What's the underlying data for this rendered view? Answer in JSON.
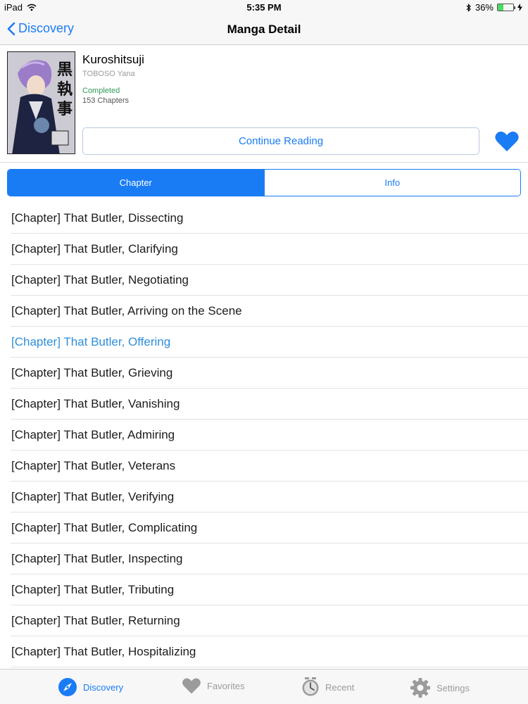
{
  "status_bar": {
    "device": "iPad",
    "time": "5:35 PM",
    "battery": "36%",
    "battery_level": 0.36
  },
  "nav": {
    "back_label": "Discovery",
    "title": "Manga Detail"
  },
  "manga": {
    "title": "Kuroshitsuji",
    "author": "TOBOSO Yana",
    "status": "Completed",
    "chapters": "153 Chapters",
    "continue_label": "Continue Reading",
    "favorited": true
  },
  "segments": {
    "chapter": "Chapter",
    "info": "Info",
    "selected": "Chapter"
  },
  "chapter_list": [
    {
      "label": "[Chapter] That Butler, Dissecting"
    },
    {
      "label": "[Chapter] That Butler, Clarifying"
    },
    {
      "label": "[Chapter] That Butler, Negotiating"
    },
    {
      "label": "[Chapter] That Butler, Arriving on the Scene"
    },
    {
      "label": "[Chapter] That Butler, Offering",
      "highlighted": true
    },
    {
      "label": "[Chapter] That Butler, Grieving"
    },
    {
      "label": "[Chapter] That Butler, Vanishing"
    },
    {
      "label": "[Chapter] That Butler, Admiring"
    },
    {
      "label": "[Chapter] That Butler, Veterans"
    },
    {
      "label": "[Chapter] That Butler, Verifying"
    },
    {
      "label": "[Chapter] That Butler, Complicating"
    },
    {
      "label": "[Chapter] That Butler, Inspecting"
    },
    {
      "label": "[Chapter] That Butler, Tributing"
    },
    {
      "label": "[Chapter] That Butler, Returning"
    },
    {
      "label": "[Chapter] That Butler, Hospitalizing"
    }
  ],
  "tabs": {
    "discovery": "Discovery",
    "favorites": "Favorites",
    "recent": "Recent",
    "settings": "Settings",
    "active": "Discovery"
  },
  "colors": {
    "accent": "#1a7cf5",
    "completed": "#2e9b57",
    "highlighted_row": "#2f8fd9",
    "tab_inactive": "#9b9b9b"
  },
  "icons": {
    "back": "chevron-left-icon",
    "favorite": "heart-icon",
    "discovery": "compass-icon",
    "favorites": "heart-icon",
    "recent": "clock-icon",
    "settings": "gear-icon"
  }
}
